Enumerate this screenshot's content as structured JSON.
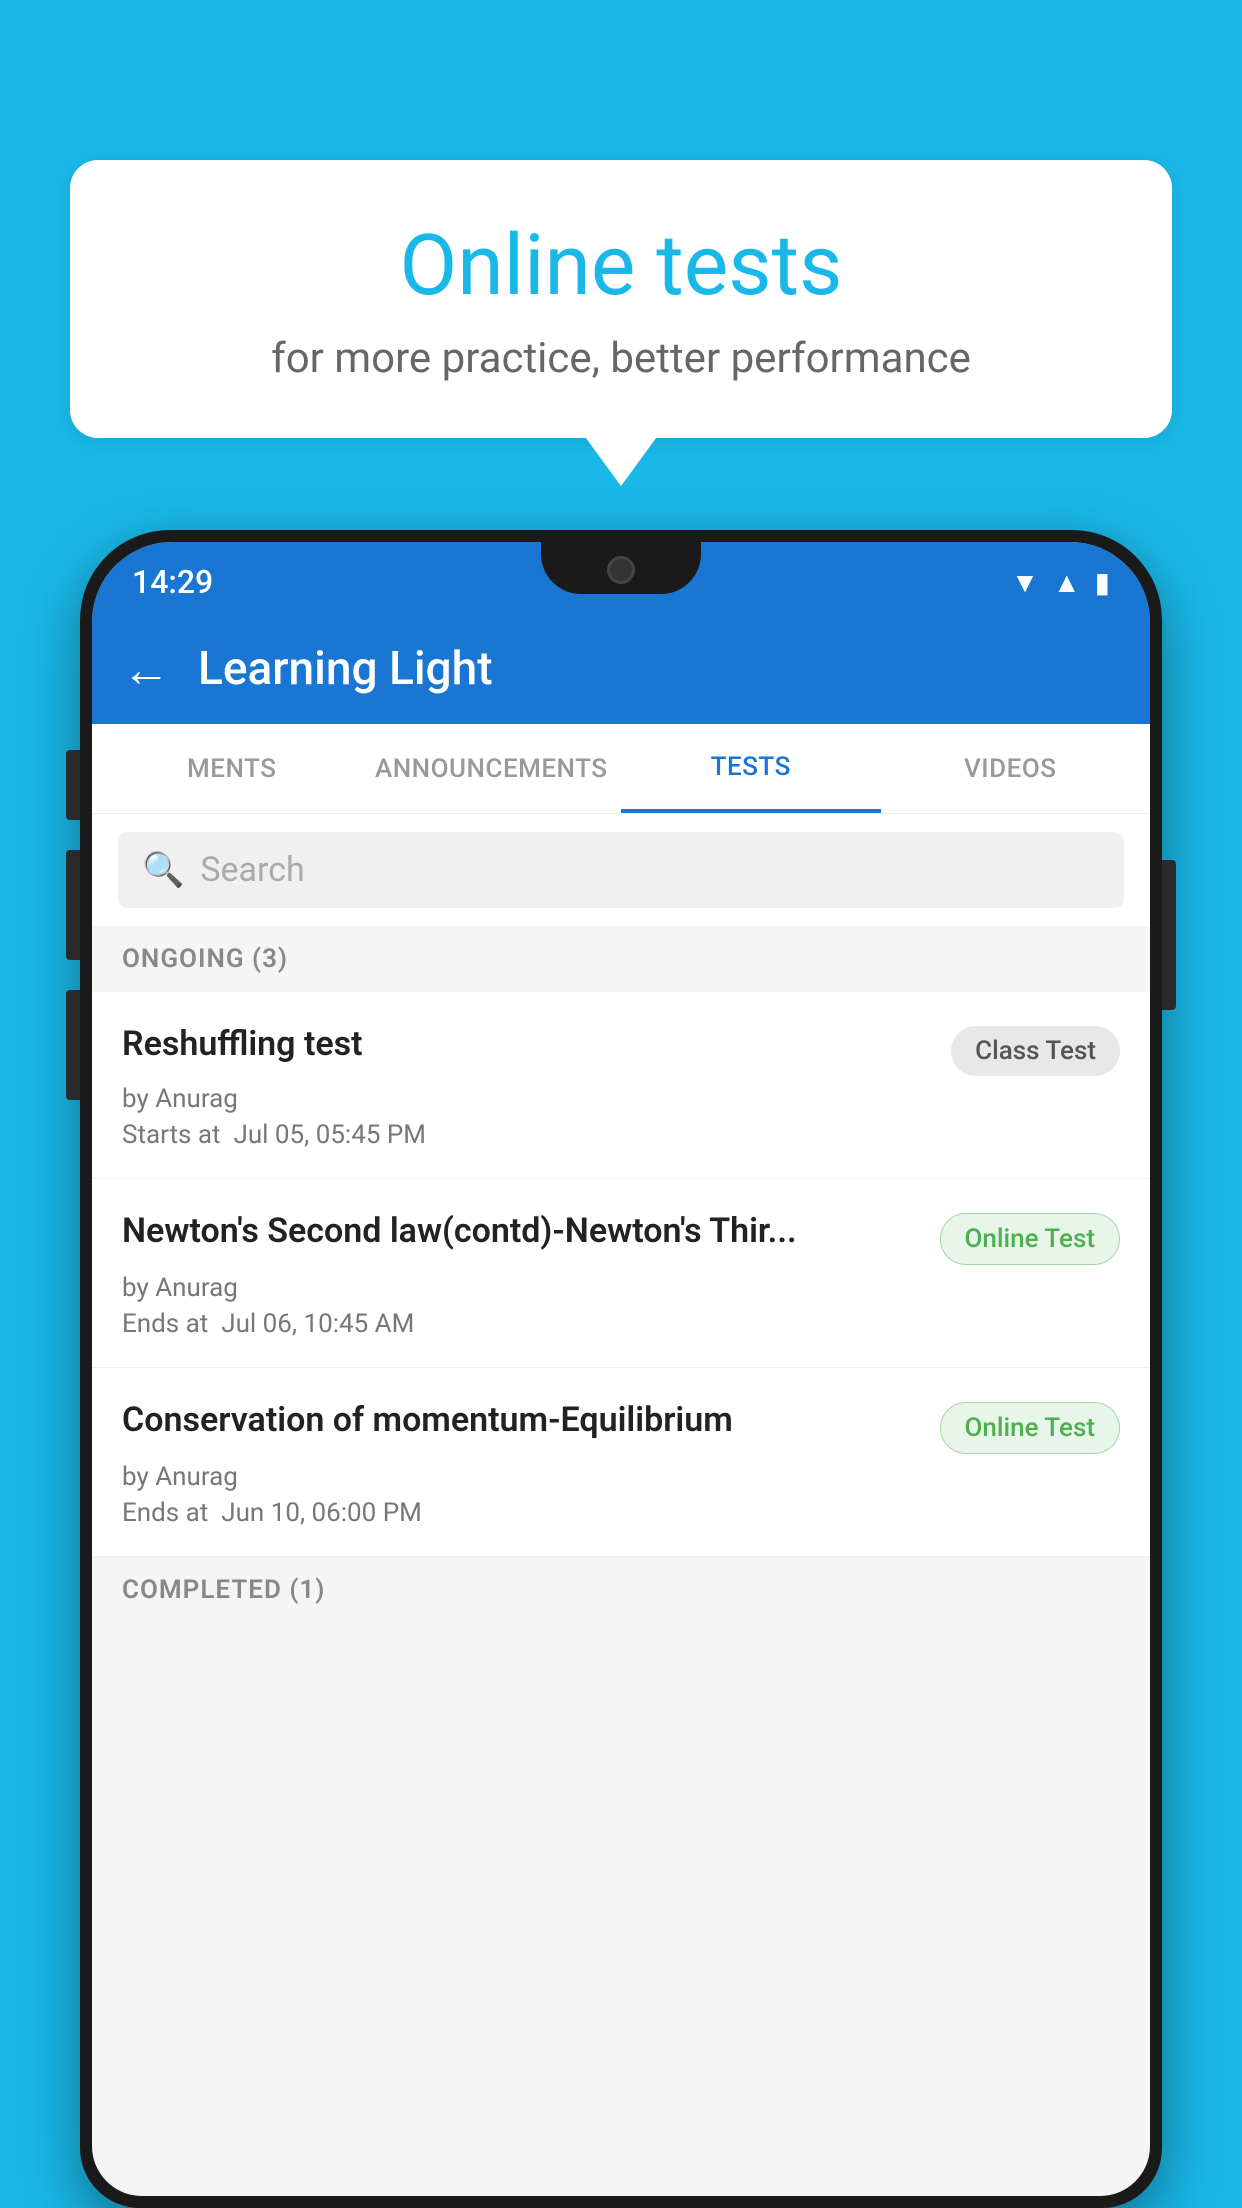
{
  "background_color": "#1ab8e8",
  "bubble": {
    "title": "Online tests",
    "subtitle": "for more practice, better performance"
  },
  "phone": {
    "status_bar": {
      "time": "14:29",
      "icons": [
        "wifi",
        "signal",
        "battery"
      ]
    },
    "app_bar": {
      "back_label": "←",
      "title": "Learning Light"
    },
    "tabs": [
      {
        "label": "MENTS",
        "active": false
      },
      {
        "label": "ANNOUNCEMENTS",
        "active": false
      },
      {
        "label": "TESTS",
        "active": true
      },
      {
        "label": "VIDEOS",
        "active": false
      }
    ],
    "search": {
      "placeholder": "Search",
      "icon": "🔍"
    },
    "ongoing_section": {
      "label": "ONGOING (3)"
    },
    "tests": [
      {
        "name": "Reshuffling test",
        "badge": "Class Test",
        "badge_type": "class",
        "by": "by Anurag",
        "time_label": "Starts at",
        "time": "Jul 05, 05:45 PM"
      },
      {
        "name": "Newton's Second law(contd)-Newton's Thir...",
        "badge": "Online Test",
        "badge_type": "online",
        "by": "by Anurag",
        "time_label": "Ends at",
        "time": "Jul 06, 10:45 AM"
      },
      {
        "name": "Conservation of momentum-Equilibrium",
        "badge": "Online Test",
        "badge_type": "online",
        "by": "by Anurag",
        "time_label": "Ends at",
        "time": "Jun 10, 06:00 PM"
      }
    ],
    "completed_section": {
      "label": "COMPLETED (1)"
    }
  }
}
